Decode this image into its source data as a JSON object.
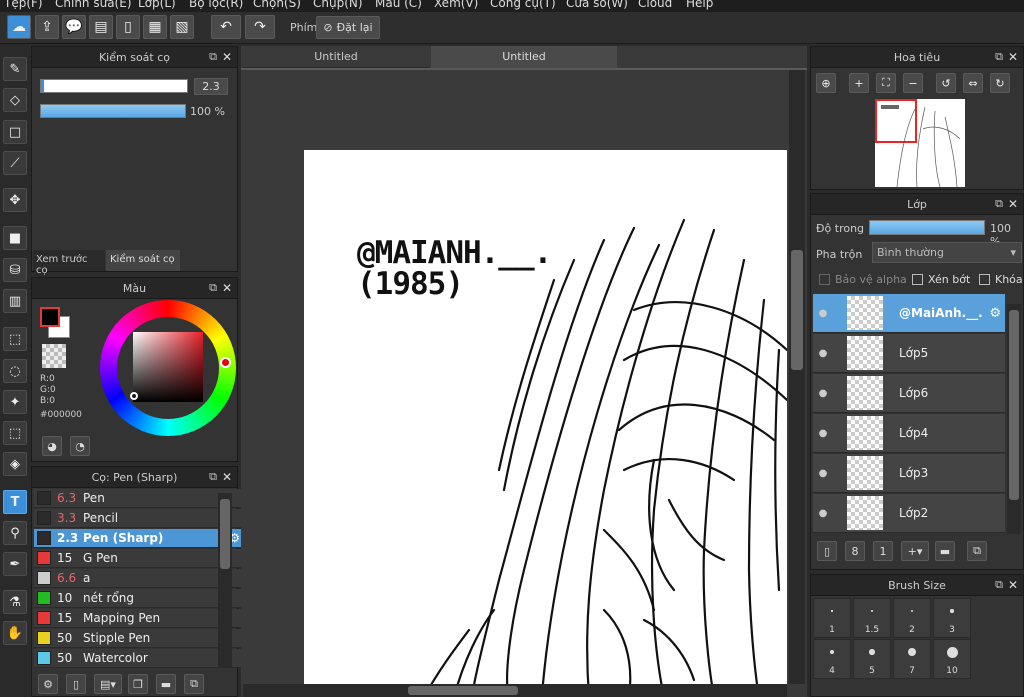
{
  "menu": [
    "Tệp(F)",
    "Chỉnh sửa(E)",
    "Lớp(L)",
    "Bộ lọc(R)",
    "Chọn(S)",
    "Chụp(N)",
    "Màu (C)",
    "Xem(V)",
    "Công cụ(T)",
    "Cửa sổ(W)",
    "Cloud",
    "Help"
  ],
  "toolbar": {
    "shortcut_label": "Phím",
    "reset_label": "Đặt lại"
  },
  "brush_control": {
    "title": "Kiểm soát cọ",
    "size_value": "2.3",
    "opacity_value": "100 %",
    "size_fraction": 0.02,
    "opacity_fraction": 1.0,
    "tab_preview": "Xem trước cọ",
    "tab_control": "Kiểm soát cọ"
  },
  "color": {
    "title": "Màu",
    "r_label": "R:0",
    "g_label": "G:0",
    "b_label": "B:0",
    "hex": "#000000",
    "current": "#000000"
  },
  "brush_list": {
    "title": "Cọ: Pen (Sharp)",
    "items": [
      {
        "size": "6.3",
        "name": "Pen",
        "color": "#2b2b2b",
        "size_color": "#e06a6a"
      },
      {
        "size": "3.3",
        "name": "Pencil",
        "color": "#2b2b2b",
        "size_color": "#e06a6a"
      },
      {
        "size": "2.3",
        "name": "Pen (Sharp)",
        "color": "#2b2b2b",
        "size_color": "#ffffff"
      },
      {
        "size": "15",
        "name": "G Pen",
        "color": "#e63a3a",
        "size_color": "#eeeeee"
      },
      {
        "size": "6.6",
        "name": "a",
        "color": "#cccccc",
        "size_color": "#e06a6a"
      },
      {
        "size": "10",
        "name": "nét rổng",
        "color": "#22bb22",
        "size_color": "#eeeeee"
      },
      {
        "size": "15",
        "name": "Mapping Pen",
        "color": "#e63a3a",
        "size_color": "#eeeeee"
      },
      {
        "size": "50",
        "name": "Stipple Pen",
        "color": "#e8d21f",
        "size_color": "#eeeeee"
      },
      {
        "size": "50",
        "name": "Watercolor",
        "color": "#5ec8e8",
        "size_color": "#eeeeee"
      }
    ]
  },
  "canvas": {
    "tabs": [
      "Untitled",
      "Untitled"
    ],
    "signature_line1": "@MAIANH.__.",
    "signature_line2": "(1985)"
  },
  "navigator": {
    "title": "Hoa tiêu"
  },
  "layers": {
    "title": "Lớp",
    "opacity_label": "Độ trong",
    "opacity_value": "100 %",
    "blend_label": "Pha trộn",
    "blend_value": "Bình thường",
    "protect_alpha": "Bảo vệ alpha",
    "clipping": "Xén bớt",
    "lock": "Khóa",
    "items": [
      "@MaiAnh.__.",
      "Lớp5",
      "Lớp6",
      "Lớp4",
      "Lớp3",
      "Lớp2"
    ]
  },
  "brush_size": {
    "title": "Brush Size",
    "sizes": [
      "1",
      "1.5",
      "2",
      "3",
      "4",
      "5",
      "7",
      "10"
    ]
  },
  "colors": {
    "accent": "#4d96d6",
    "selected_brush": "#e63a3a"
  }
}
